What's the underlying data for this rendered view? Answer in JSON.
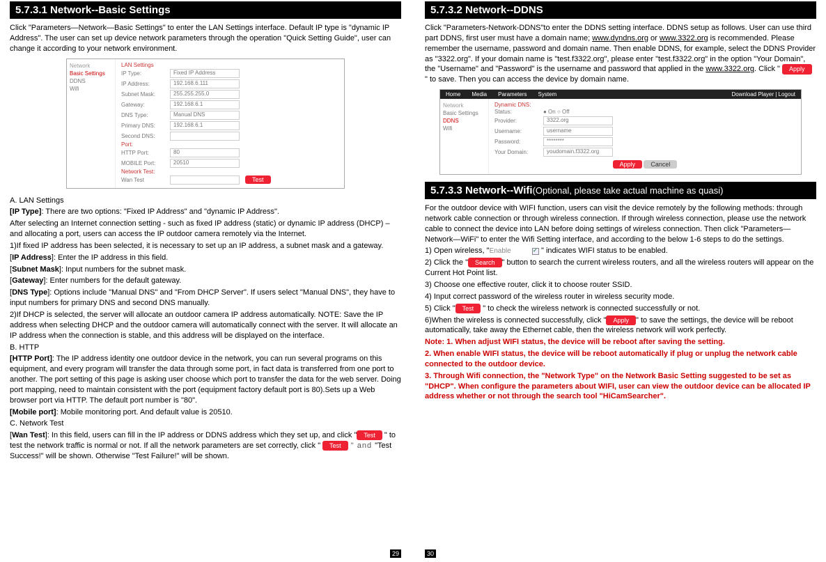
{
  "left": {
    "title": "5.7.3.1 Network--Basic Settings",
    "intro": "Click \"Parameters—Network—Basic Settings\" to enter the LAN Settings interface. Default IP type is \"dynamic IP Address\". The user can set up device network parameters through the operation \"Quick Setting Guide\", user can change it according to your network environment.",
    "shot": {
      "nav": {
        "side_head": "Network",
        "side": [
          "Basic Settings",
          "DDNS",
          "Wifi"
        ],
        "hl_index": 0,
        "group1": "LAN Settings",
        "rows1": [
          {
            "l": "IP Type:",
            "v": "Fixed IP Address"
          },
          {
            "l": "IP Address:",
            "v": "192.168.6.111"
          },
          {
            "l": "Subnet Mask:",
            "v": "255.255.255.0"
          },
          {
            "l": "Gateway:",
            "v": "192.168.6.1"
          },
          {
            "l": "DNS Type:",
            "v": "Manual DNS"
          },
          {
            "l": "Primary DNS:",
            "v": "192.168.6.1"
          },
          {
            "l": "Second DNS:",
            "v": ""
          }
        ],
        "group2": "Port:",
        "rows2": [
          {
            "l": "HTTP Port:",
            "v": "80"
          },
          {
            "l": "MOBILE Port:",
            "v": "20510"
          }
        ],
        "group3": "Network Test:",
        "rows3": [
          {
            "l": "Wan Test",
            "v": ""
          }
        ],
        "test_btn": "Test"
      }
    },
    "a_head": "A. LAN Settings",
    "iptype_lbl": "[IP Type]",
    "iptype_txt": ": There are two options: \"Fixed IP Address\" and \"dynamic IP Address\".",
    "after_sel": "After selecting an Internet connection setting - such as fixed IP address (static) or dynamic IP address (DHCP) – and allocating a port, users can access the IP outdoor camera remotely via the Internet.",
    "one": "1)If fixed IP address has been selected, it is necessary to set up an IP address, a subnet mask and a gateway.",
    "ipaddr_lbl": "[IP Address]",
    "ipaddr_txt": ": Enter the IP address in this field.",
    "subnet_lbl": "[Subnet Mask]",
    "subnet_txt": ": Input numbers for the subnet mask.",
    "gw_lbl": "[Gateway]",
    "gw_txt": ": Enter numbers for the default gateway.",
    "dns_lbl": "[DNS Type]",
    "dns_txt": ": Options include \"Manual DNS\" and \"From DHCP Server\". If users select \"Manual DNS\", they have to input numbers for primary DNS and second DNS manually.",
    "two": "2)If DHCP is selected, the server will allocate an outdoor camera IP address automatically. NOTE: Save the IP address when selecting DHCP and the outdoor camera will automatically connect with the server. It will allocate an IP address when the connection is stable, and this address will be displayed on the interface.",
    "b_head": "B. HTTP",
    "http_lbl": "[HTTP Port]",
    "http_txt": ": The IP address identity one outdoor device  in the network, you can run several programs on this equipment, and every program will transfer the data through some port, in fact data is transferred from one port to another. The port setting of this page is asking user choose which port to transfer the data for the web server. Doing port mapping, need to maintain consistent with the port (equipment factory default port is 80).Sets up a Web browser port via HTTP. The default port number is \"80\".",
    "mob_lbl": "[Mobile port]",
    "mob_txt": ": Mobile monitoring port. And default value is 20510.",
    "c_head": "C. Network Test",
    "wan_lbl": "[Wan Test]",
    "wan_txt1": ": In this field, users can fill in the IP address or DDNS address which they set up, and click \"",
    "wan_btn1": "Test",
    "wan_txt2": " \" to test the network traffic is normal or not. If all the network parameters are set correctly, click \" ",
    "wan_btn2": "Test",
    "wan_and": " \" and ",
    "wan_txt3": "\"Test Success!\" will be shown. Otherwise \"Test Failure!\" will be shown.",
    "pgnum": "29"
  },
  "right": {
    "title1": "5.7.3.2 Network--DDNS",
    "ddns_p1a": "Click \"Parameters-Network-DDNS\"to enter the DDNS setting interface. DDNS setup as follows. User can use third part DDNS, first user must have a domain name; ",
    "ddns_link1": "www.dyndns.org",
    "ddns_p1b": " or ",
    "ddns_link2": "www.3322.org",
    "ddns_p1c": " is recommended. Please remember the username, password and domain name. Then enable DDNS, for example, select the DDNS Provider as \"3322.org\". If your domain name is \"test.f3322.org\", please enter \"test.f3322.org\" in the option \"Your Domain\", the \"Username\" and \"Password\" is the username and password that applied in the ",
    "ddns_link3": "www.3322.org",
    "ddns_p1d": ". Click \" ",
    "ddns_btn": "Apply",
    "ddns_p1e": " \"    to save. Then you can access the device by domain name.",
    "shot2": {
      "top": [
        "Home",
        "Media",
        "Parameters",
        "System"
      ],
      "top_right": "Download Player | Logout",
      "side_head": "Network",
      "side": [
        "Basic Settings",
        "DDNS",
        "Wifi"
      ],
      "hl_index": 1,
      "group": "Dynamic DNS:",
      "rows": [
        {
          "l": "Status:",
          "v": "● On  ○ Off"
        },
        {
          "l": "Provider:",
          "v": "3322.org"
        },
        {
          "l": "Username:",
          "v": "username"
        },
        {
          "l": "Password:",
          "v": "********"
        },
        {
          "l": "Your Domain:",
          "v": "youdomain.f3322.org"
        }
      ],
      "apply": "Apply",
      "cancel": "Cancel"
    },
    "title2a": "5.7.3.3 Network--Wifi",
    "title2b": "(Optional, please take actual machine as quasi)",
    "wifi_p1": "For the outdoor device  with WIFI function, users can visit the device remotely by the following methods: through network cable connection or through wireless connection. If through wireless connection, please use the network cable to connect the device into LAN before doing settings of wireless connection. Then click \"Parameters—Network—WiFi\" to enter the Wifi Setting interface, and according to the below 1-6 steps to do the settings.",
    "wifi_s1a": "1) Open wireless, \"",
    "wifi_enable_lbl": "Enable",
    "wifi_s1b": " \" indicates WIFI status to be enabled.",
    "wifi_s2a": "2) Click the \"",
    "wifi_search_btn": "Search",
    "wifi_s2b": "\" button to search the current wireless routers, and all the wireless routers will appear on the Current Hot Point list.",
    "wifi_s3": "3) Choose one effective router, click it to choose router SSID.",
    "wifi_s4": "4) Input correct password of the wireless router in wireless security mode.",
    "wifi_s5a": "5) Click \"",
    "wifi_test_btn": "Test",
    "wifi_s5b": " \" to check the wireless network is connected successfully or not.",
    "wifi_s6a": "6)When the wireless is connected successfully, click \"",
    "wifi_apply_btn": "Apply",
    "wifi_s6b": "\" to save the settings, the device will be reboot automatically, take away the Ethernet cable, then the wireless network will work perfectly.",
    "note1": "Note: 1. When adjust WIFI status, the device will be reboot after saving the setting.",
    "note2": "2. When enable WIFI status, the device will be reboot automatically if plug or unplug the network cable connected to the outdoor device.",
    "note3": "3. Through Wifi connection, the \"Network Type\" on the Network Basic Setting suggested to be set as \"DHCP\". When configure the parameters about WIFI, user can view the outdoor device can be allocated IP address whether or not through the search tool \"HiCamSearcher\".",
    "pgnum": "30"
  }
}
